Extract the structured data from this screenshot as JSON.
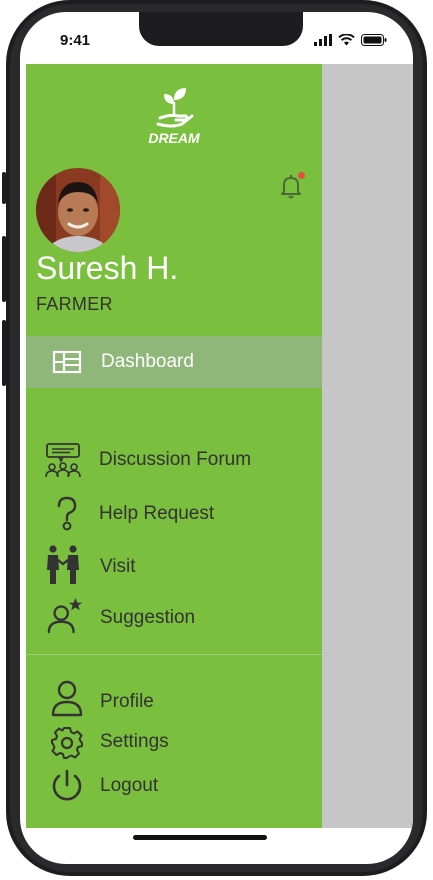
{
  "status_bar": {
    "time": "9:41"
  },
  "app": {
    "logo_text": "DREAM"
  },
  "user": {
    "name": "Suresh H.",
    "role": "FARMER"
  },
  "nav": {
    "primary": [
      {
        "label": "Dashboard",
        "icon": "dashboard-icon",
        "active": true
      }
    ],
    "secondary": [
      {
        "label": "Discussion Forum",
        "icon": "discussion-forum-icon"
      },
      {
        "label": "Help Request",
        "icon": "help-request-icon"
      },
      {
        "label": "Visit",
        "icon": "visit-icon"
      },
      {
        "label": "Suggestion",
        "icon": "suggestion-icon"
      }
    ],
    "account": [
      {
        "label": "Profile",
        "icon": "profile-icon"
      },
      {
        "label": "Settings",
        "icon": "settings-icon"
      },
      {
        "label": "Logout",
        "icon": "logout-icon"
      }
    ]
  },
  "colors": {
    "drawer_bg": "#7abf3e",
    "active_item_bg": "#90b77a",
    "overlay": "#c6c6c6",
    "notification_dot": "#e74c3c"
  }
}
